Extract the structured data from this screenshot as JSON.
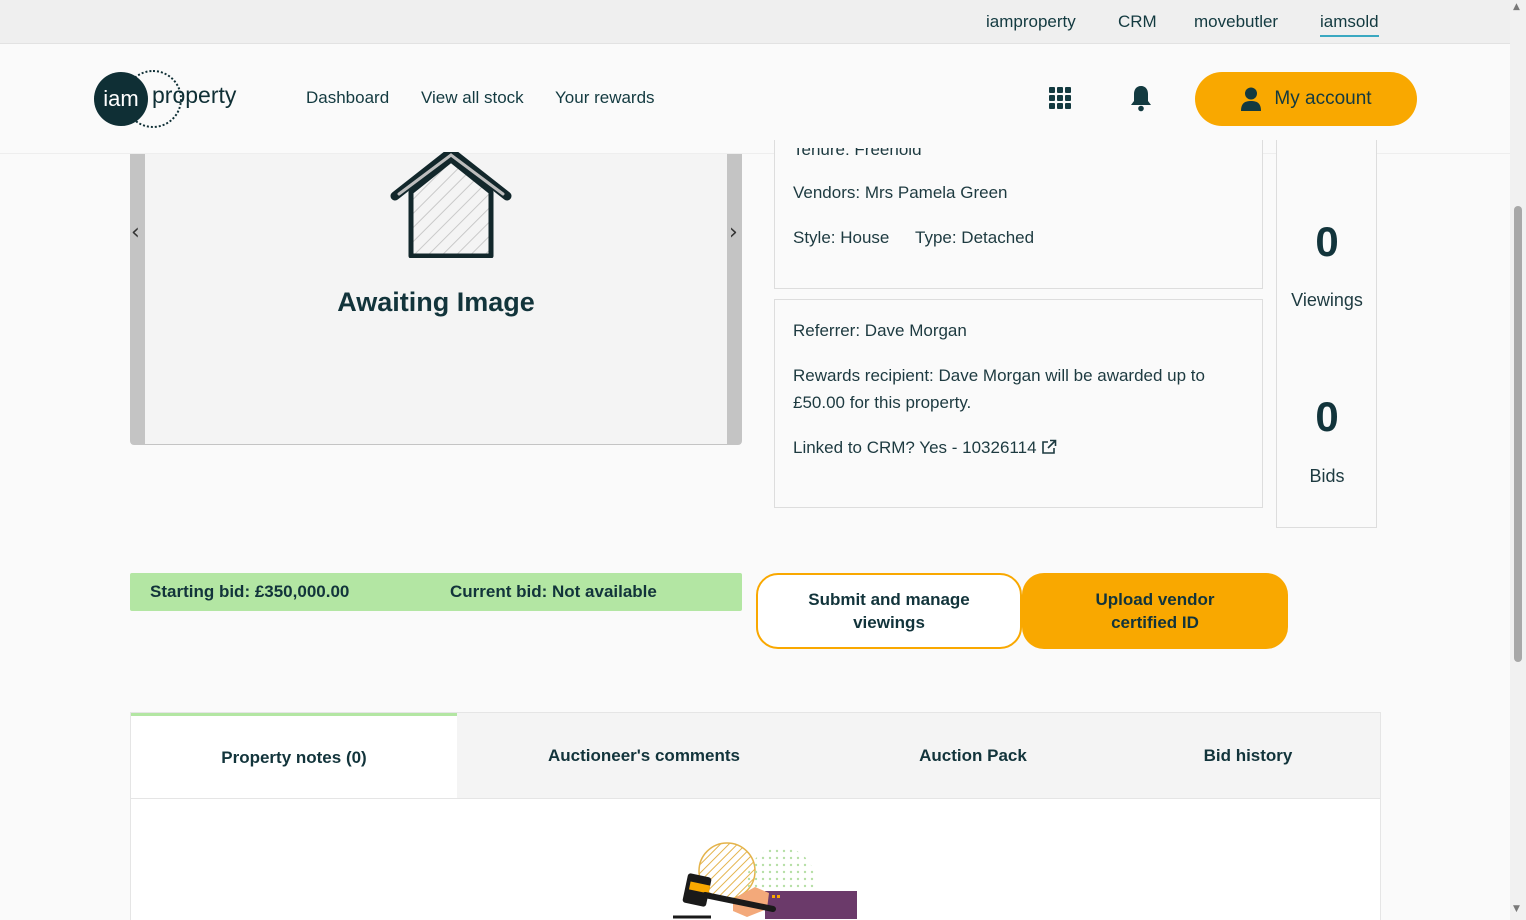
{
  "topbar": {
    "links": [
      "iamproperty",
      "CRM",
      "movebutler",
      "iamsold"
    ]
  },
  "header": {
    "logo_mark": "iam",
    "logo_text": "property",
    "nav": [
      "Dashboard",
      "View all stock",
      "Your rewards"
    ],
    "account_label": "My account"
  },
  "carousel": {
    "prev": "‹",
    "next": "›",
    "placeholder_text": "Awaiting Image"
  },
  "vendor_box": {
    "tenure_partial": "Tenure: Freehold",
    "vendors": "Vendors: Mrs Pamela Green",
    "style": "Style: House",
    "type": "Type: Detached"
  },
  "referrer_box": {
    "referrer": "Referrer: Dave Morgan",
    "rewards_line1": "Rewards recipient: Dave Morgan will be awarded up to",
    "rewards_line2": "£50.00 for this property.",
    "crm": "Linked to CRM? Yes - 10326114"
  },
  "stats": {
    "viewings_count": "0",
    "viewings_label": "Viewings",
    "bids_count": "0",
    "bids_label": "Bids"
  },
  "bid_bar": {
    "starting_bid": "Starting bid: £350,000.00",
    "current_bid": "Current bid: Not available"
  },
  "actions": {
    "viewings_line1": "Submit and manage",
    "viewings_line2": "viewings",
    "upload_line1": "Upload vendor",
    "upload_line2": "certified ID"
  },
  "tabs": [
    "Property notes (0)",
    "Auctioneer's comments",
    "Auction Pack",
    "Bid history"
  ],
  "colors": {
    "accent_orange": "#f9a800",
    "bid_green": "#b3e6a3",
    "brand_dark": "#0f2f35"
  }
}
